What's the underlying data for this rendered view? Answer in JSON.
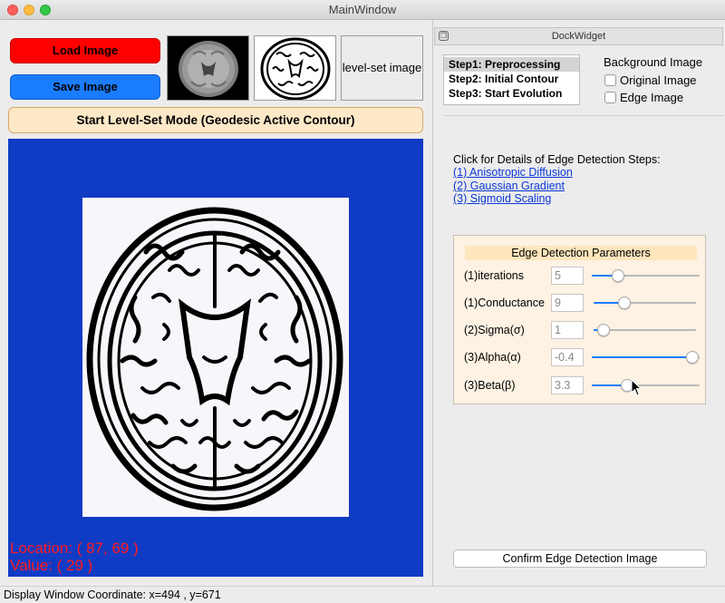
{
  "window": {
    "title": "MainWindow"
  },
  "buttons": {
    "load_image": "Load Image",
    "save_image": "Save Image",
    "start_mode": "Start Level-Set Mode (Geodesic Active Contour)",
    "confirm": "Confirm Edge Detection Image"
  },
  "thumbnails": {
    "third_label": "level-set image"
  },
  "display": {
    "location": "Location: ( 87, 69 )",
    "value": "Value: ( 29 )"
  },
  "status": {
    "text": "Display Window Coordinate: x=494 , y=671"
  },
  "dock": {
    "title": "DockWidget",
    "steps": [
      "Step1: Preprocessing",
      "Step2: Initial Contour",
      "Step3: Start Evolution"
    ],
    "background_label": "Background Image",
    "options": [
      "Original Image",
      "Edge Image"
    ],
    "details_label": "Click for Details of Edge Detection Steps:",
    "links": [
      "(1) Anisotropic Diffusion",
      "(2) Gaussian Gradient",
      "(3) Sigmoid Scaling"
    ]
  },
  "params": {
    "title": "Edge Detection Parameters",
    "items": [
      {
        "label": "(1)iterations",
        "value": "5",
        "level": 0.24
      },
      {
        "label": "(1)Conductance",
        "value": "9",
        "level": 0.3
      },
      {
        "label": "(2)Sigma(σ)",
        "value": "1",
        "level": 0.1
      },
      {
        "label": "(3)Alpha(α)",
        "value": "-0.4",
        "level": 0.93
      },
      {
        "label": "(3)Beta(β)",
        "value": "3.3",
        "level": 0.33
      }
    ]
  },
  "colors": {
    "load_button": "#ff0000",
    "save_button": "#1a7cff",
    "canvas_bg": "#103bc4",
    "overlay_text": "#ff1a1a",
    "link": "#0a37d6",
    "params_panel": "#fdf2e3"
  }
}
